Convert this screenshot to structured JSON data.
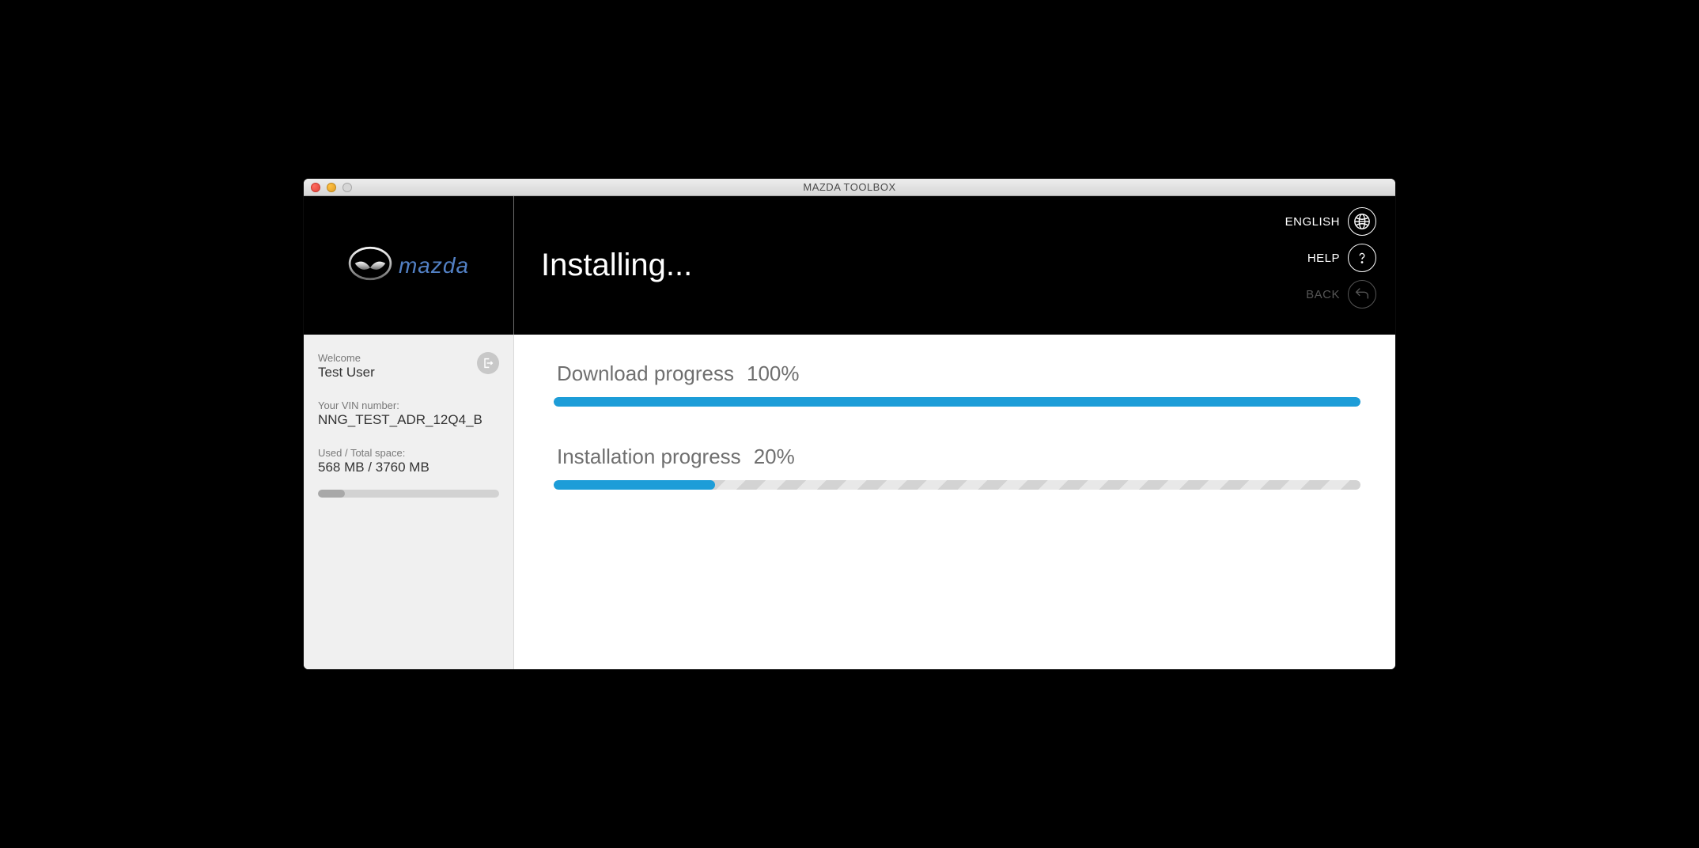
{
  "window": {
    "title": "MAZDA TOOLBOX"
  },
  "header": {
    "page_title": "Installing...",
    "buttons": {
      "language": "ENGLISH",
      "help": "HELP",
      "back": "BACK"
    }
  },
  "sidebar": {
    "welcome_label": "Welcome",
    "username": "Test User",
    "vin_label": "Your VIN number:",
    "vin_value": "NNG_TEST_ADR_12Q4_B",
    "space_label": "Used / Total space:",
    "space_value": "568 MB / 3760 MB",
    "storage_percent": 15
  },
  "progress": {
    "download": {
      "label": "Download progress",
      "percent_text": "100%",
      "percent": 100
    },
    "install": {
      "label": "Installation progress",
      "percent_text": "20%",
      "percent": 20
    }
  }
}
